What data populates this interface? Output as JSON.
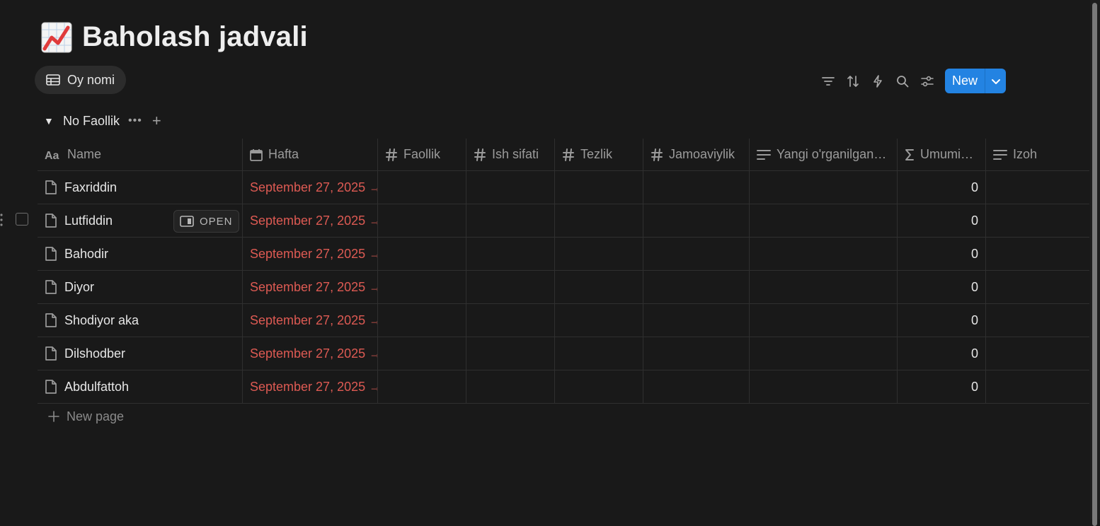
{
  "page": {
    "emoji_icon": "chart-increasing-icon",
    "title": "Baholash jadvali"
  },
  "view": {
    "tab_label": "Oy nomi",
    "tab_icon": "table-icon"
  },
  "toolbar": {
    "icons": [
      "filter-icon",
      "sort-icon",
      "automation-icon",
      "search-icon",
      "settings-icon"
    ],
    "new_label": "New"
  },
  "group": {
    "label": "No Faollik"
  },
  "columns": [
    {
      "label": "Name",
      "icon": "text-property-icon"
    },
    {
      "label": "Hafta",
      "icon": "calendar-icon"
    },
    {
      "label": "Faollik",
      "icon": "number-icon"
    },
    {
      "label": "Ish sifati",
      "icon": "number-icon"
    },
    {
      "label": "Tezlik",
      "icon": "number-icon"
    },
    {
      "label": "Jamoaviylik",
      "icon": "number-icon"
    },
    {
      "label": "Yangi o'rganilgan …",
      "icon": "text-lines-icon"
    },
    {
      "label": "Umumi…",
      "icon": "formula-sigma-icon"
    },
    {
      "label": "Izoh",
      "icon": "text-lines-icon"
    }
  ],
  "rows": [
    {
      "name": "Faxriddin",
      "hafta": "September 27, 2025 →",
      "umumiy": "0"
    },
    {
      "name": "Lutfiddin",
      "hafta": "September 27, 2025 →",
      "umumiy": "0"
    },
    {
      "name": "Bahodir",
      "hafta": "September 27, 2025 →",
      "umumiy": "0"
    },
    {
      "name": "Diyor",
      "hafta": "September 27, 2025 →",
      "umumiy": "0"
    },
    {
      "name": "Shodiyor aka",
      "hafta": "September 27, 2025 →",
      "umumiy": "0"
    },
    {
      "name": "Dilshodber",
      "hafta": "September 27, 2025 →",
      "umumiy": "0"
    },
    {
      "name": "Abdulfattoh",
      "hafta": "September 27, 2025 →",
      "umumiy": "0"
    }
  ],
  "row_open_label": "OPEN",
  "new_page_label": "New page",
  "colors": {
    "accent": "#2383e2",
    "date_text": "#dd5a53",
    "background": "#191919"
  }
}
